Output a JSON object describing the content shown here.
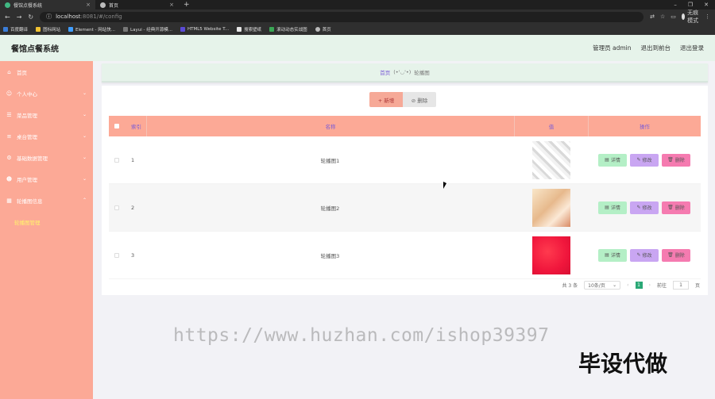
{
  "browser": {
    "tabs": [
      {
        "title": "餐馆点餐系统",
        "active": true
      },
      {
        "title": "首页",
        "active": false
      }
    ],
    "new_tab": "+",
    "url_host": "localhost",
    "url_rest": ":8081/#/config",
    "profile": "无痕模式",
    "bookmarks": [
      "百度翻译",
      "图标网站",
      "Element - 网站快...",
      "Layui - 经典开源模...",
      "HTML5 Website T...",
      "搜索壁纸",
      "滚动动态实战图",
      "首页"
    ]
  },
  "header": {
    "title": "餐馆点餐系统",
    "links": [
      "管理员 admin",
      "退出到前台",
      "退出登录"
    ]
  },
  "sidebar": {
    "items": [
      {
        "label": "首页",
        "icon": "home-icon",
        "chev": ""
      },
      {
        "label": "个人中心",
        "icon": "user-icon",
        "chev": "⌄"
      },
      {
        "label": "菜品管理",
        "icon": "menu-icon",
        "chev": "⌄"
      },
      {
        "label": "桌台管理",
        "icon": "list-icon",
        "chev": "⌄"
      },
      {
        "label": "基础数据管理",
        "icon": "gear-icon",
        "chev": "⌄"
      },
      {
        "label": "用户管理",
        "icon": "users-icon",
        "chev": "⌄"
      },
      {
        "label": "轮播图信息",
        "icon": "grid-icon",
        "chev": "⌃"
      }
    ],
    "active_sub": "轮播图管理"
  },
  "breadcrumb": {
    "home": "首页",
    "emote": "(•'◡'•)",
    "current": "轮播图"
  },
  "toolbar": {
    "add": "+ 新增",
    "delete": "⊘ 删除"
  },
  "table": {
    "columns": [
      "索引",
      "名称",
      "值",
      "操作"
    ],
    "rows": [
      {
        "index": "1",
        "name": "轮播图1"
      },
      {
        "index": "2",
        "name": "轮播图2"
      },
      {
        "index": "3",
        "name": "轮播图3"
      }
    ],
    "actions": {
      "detail": "详情",
      "edit": "修改",
      "remove": "删除"
    }
  },
  "pager": {
    "total": "共 3 条",
    "page_size": "10条/页",
    "prev": "‹",
    "current": "1",
    "next": "›",
    "goto_label": "前往",
    "goto_value": "1",
    "page_suffix": "页"
  },
  "overlay": {
    "watermark": "https://www.huzhan.com/ishop39397",
    "badge": "毕设代做"
  },
  "colors": {
    "sidebar": "#fca996",
    "header": "#e6f3ea",
    "accent_purple": "#7a5cd6",
    "active_sub": "#fff46c"
  }
}
